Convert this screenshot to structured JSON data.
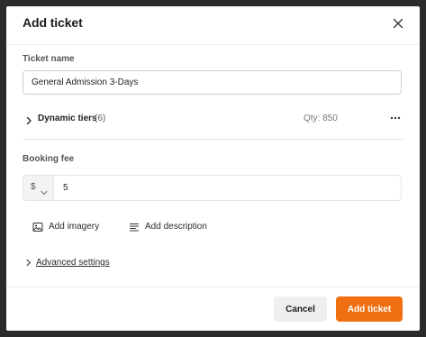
{
  "dialog": {
    "title": "Add ticket",
    "close_icon": "close-icon"
  },
  "ticket_name": {
    "label": "Ticket name",
    "value": "General Admission 3-Days"
  },
  "dynamic_tiers": {
    "label": "Dynamic tiers",
    "count": "(6)",
    "quantity": "Qty: 850",
    "expand_icon": "chevron-right-icon",
    "menu_icon": "more-horizontal-icon"
  },
  "booking_fee": {
    "label": "Booking fee",
    "currency": "$",
    "value": "5"
  },
  "actions": {
    "add_imagery": "Add imagery",
    "add_description": "Add description"
  },
  "advanced": {
    "label": "Advanced settings"
  },
  "footer": {
    "cancel_label": "Cancel",
    "submit_label": "Add ticket"
  },
  "colors": {
    "accent": "#f07011",
    "backdrop": "#2b2b2b"
  }
}
